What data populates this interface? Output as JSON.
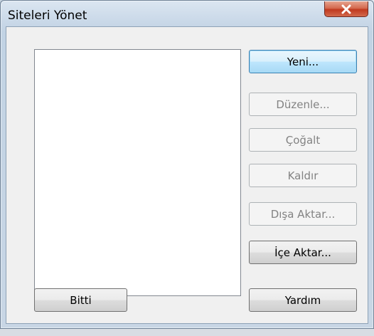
{
  "window": {
    "title": "Siteleri Yönet"
  },
  "buttons": {
    "new": "Yeni...",
    "edit": "Düzenle...",
    "duplicate": "Çoğalt",
    "remove": "Kaldır",
    "export": "Dışa Aktar...",
    "import": "İçe Aktar...",
    "done": "Bitti",
    "help": "Yardım"
  },
  "sites_list": {
    "items": []
  },
  "colors": {
    "close_button": "#c0391f",
    "default_button_border": "#3c7fb1",
    "disabled_text": "#838383"
  }
}
